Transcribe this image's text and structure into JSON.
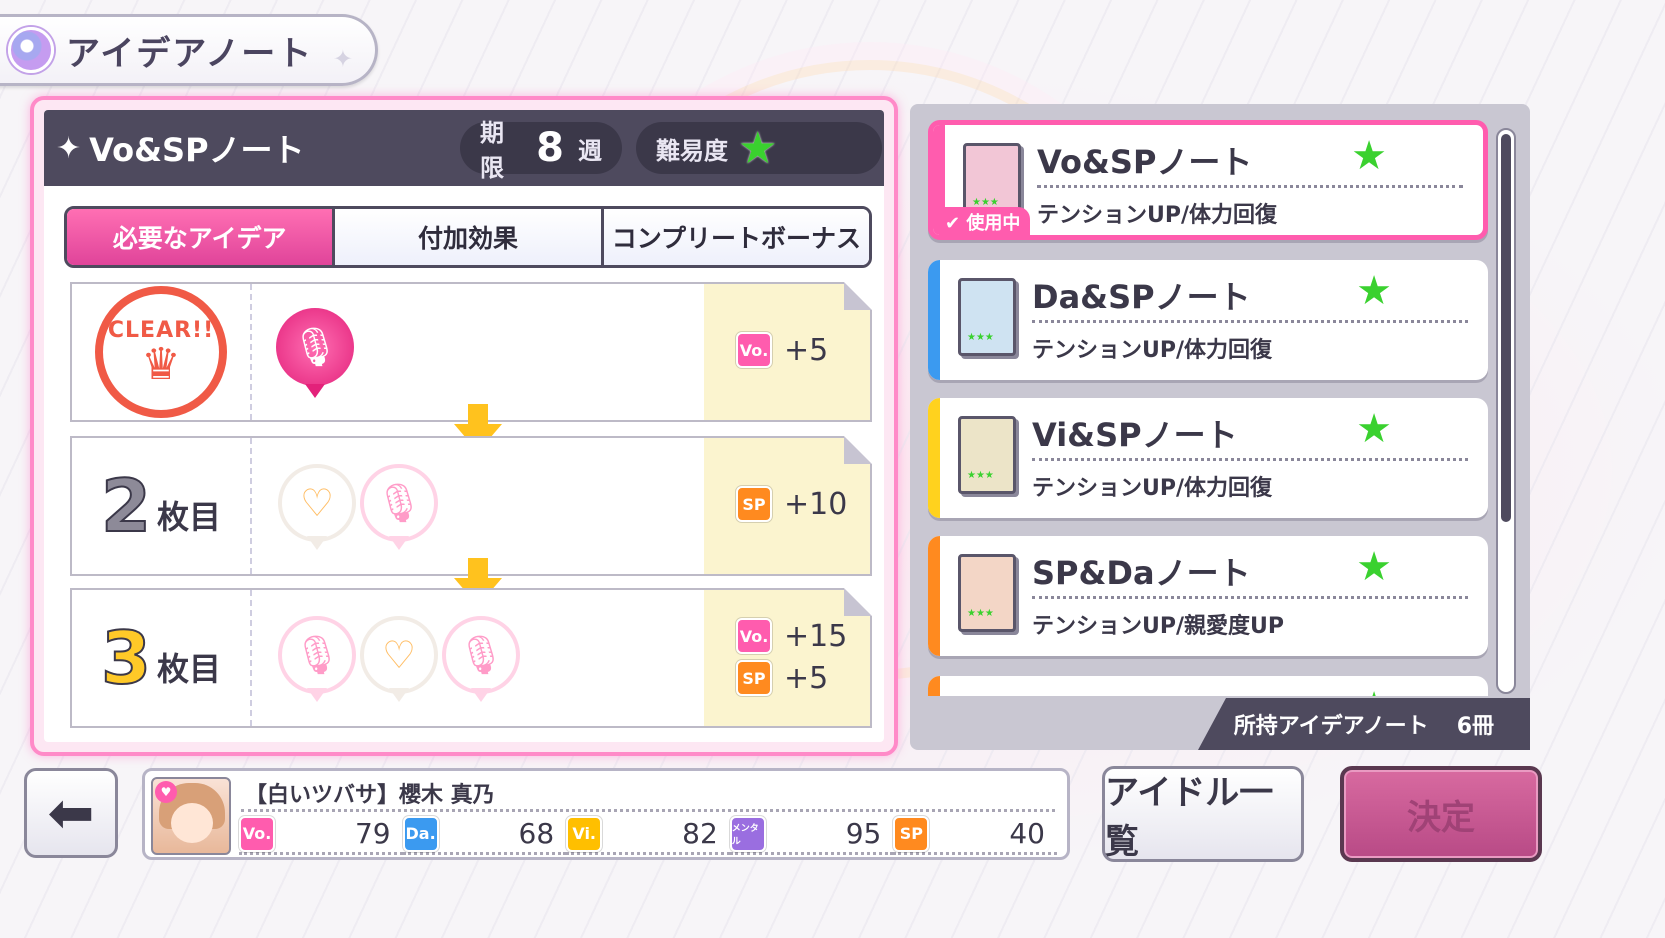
{
  "title": "アイデアノート",
  "note": {
    "name": "Vo&SPノート",
    "deadline_label": "期限",
    "deadline_value": "8",
    "deadline_unit": "週",
    "difficulty_label": "難易度",
    "tabs": [
      "必要なアイデア",
      "付加効果",
      "コンプリートボーナス"
    ],
    "active_tab": 0,
    "rows": [
      {
        "count_label": "",
        "icons": [
          "mic-filled"
        ],
        "rewards": [
          {
            "badge": "Vo.",
            "value": "+5"
          }
        ]
      },
      {
        "count_num": "2",
        "count_suffix": "枚目",
        "icons": [
          "heart-ghost",
          "mic-ghost"
        ],
        "rewards": [
          {
            "badge": "SP",
            "value": "+10"
          }
        ]
      },
      {
        "count_num": "3",
        "count_suffix": "枚目",
        "icons": [
          "mic-ghost",
          "heart-ghost",
          "mic-ghost"
        ],
        "rewards": [
          {
            "badge": "Vo.",
            "value": "+15"
          },
          {
            "badge": "SP",
            "value": "+5"
          }
        ]
      }
    ],
    "clear_stamp": "CLEAR!!"
  },
  "note_list": [
    {
      "name": "Vo&SPノート",
      "effect": "テンションUP/体力回復",
      "color": "#ff5cae",
      "book": "#f2c6d6",
      "selected": true,
      "in_use": "使用中"
    },
    {
      "name": "Da&SPノート",
      "effect": "テンションUP/体力回復",
      "color": "#3b9af0",
      "book": "#cfe3f2",
      "selected": false
    },
    {
      "name": "Vi&SPノート",
      "effect": "テンションUP/体力回復",
      "color": "#ffd21e",
      "book": "#ece4c8",
      "selected": false
    },
    {
      "name": "SP&Daノート",
      "effect": "テンションUP/親愛度UP",
      "color": "#ff8a1f",
      "book": "#f3d6c6",
      "selected": false
    }
  ],
  "owned": {
    "label": "所持アイデアノート",
    "value": "6冊"
  },
  "idol": {
    "name": "【白いツバサ】櫻木 真乃",
    "stats": [
      {
        "badge": "Vo.",
        "value": "79"
      },
      {
        "badge": "Da.",
        "value": "68"
      },
      {
        "badge": "Vi.",
        "value": "82"
      },
      {
        "badge": "メンタル",
        "value": "95"
      },
      {
        "badge": "SP",
        "value": "40"
      }
    ]
  },
  "buttons": {
    "idol_list": "アイドル一覧",
    "confirm": "決定"
  }
}
